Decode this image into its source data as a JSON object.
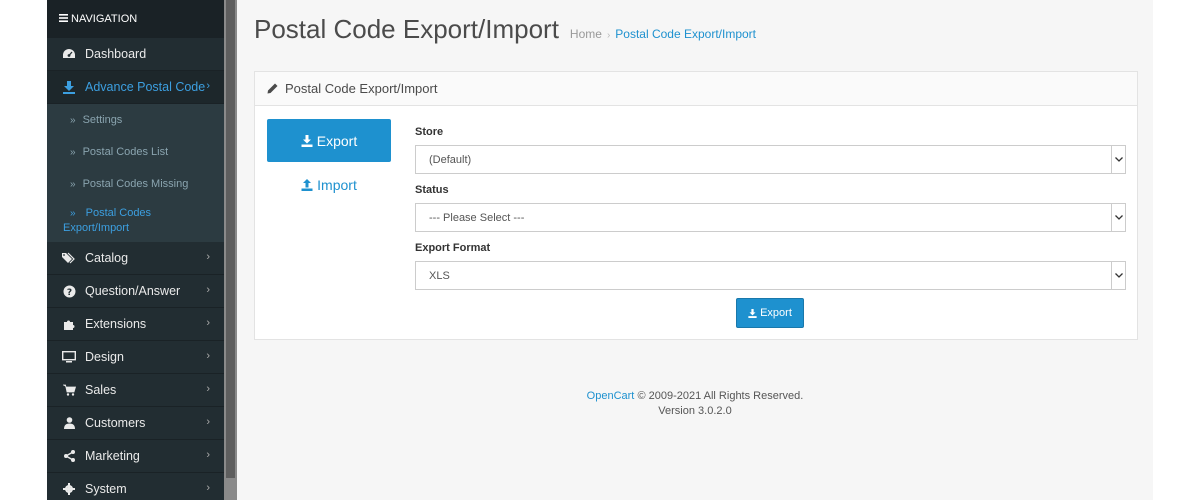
{
  "nav": {
    "header": "NAVIGATION",
    "items": [
      {
        "label": "Dashboard",
        "icon": "dashboard-icon"
      },
      {
        "label": "Advance Postal Code",
        "icon": "download-icon",
        "active": true
      },
      {
        "label": "Catalog",
        "icon": "tags-icon"
      },
      {
        "label": "Question/Answer",
        "icon": "question-icon"
      },
      {
        "label": "Extensions",
        "icon": "puzzle-icon"
      },
      {
        "label": "Design",
        "icon": "monitor-icon"
      },
      {
        "label": "Sales",
        "icon": "cart-icon"
      },
      {
        "label": "Customers",
        "icon": "user-icon"
      },
      {
        "label": "Marketing",
        "icon": "share-icon"
      },
      {
        "label": "System",
        "icon": "gear-icon"
      }
    ],
    "sub_items": [
      {
        "label": "Settings"
      },
      {
        "label": "Postal Codes List"
      },
      {
        "label": "Postal Codes Missing"
      },
      {
        "label_line1": "Postal Codes",
        "label_line2": "Export/Import",
        "active": true
      }
    ]
  },
  "page": {
    "title": "Postal Code Export/Import",
    "breadcrumb_home": "Home",
    "breadcrumb_current": "Postal Code Export/Import"
  },
  "panel": {
    "heading": "Postal Code Export/Import",
    "tabs": [
      {
        "label": "Export",
        "active": true
      },
      {
        "label": "Import",
        "active": false
      }
    ],
    "fields": [
      {
        "label": "Store",
        "value": "(Default)"
      },
      {
        "label": "Status",
        "value": "--- Please Select ---"
      },
      {
        "label": "Export Format",
        "value": "XLS"
      }
    ],
    "export_button": "Export"
  },
  "footer": {
    "link": "OpenCart",
    "copyright": "© 2009-2021 All Rights Reserved.",
    "version": "Version 3.0.2.0"
  },
  "colors": {
    "sidebar_bg": "#222d32",
    "accent": "#1e91cf",
    "active_link": "#3c9fe0"
  }
}
